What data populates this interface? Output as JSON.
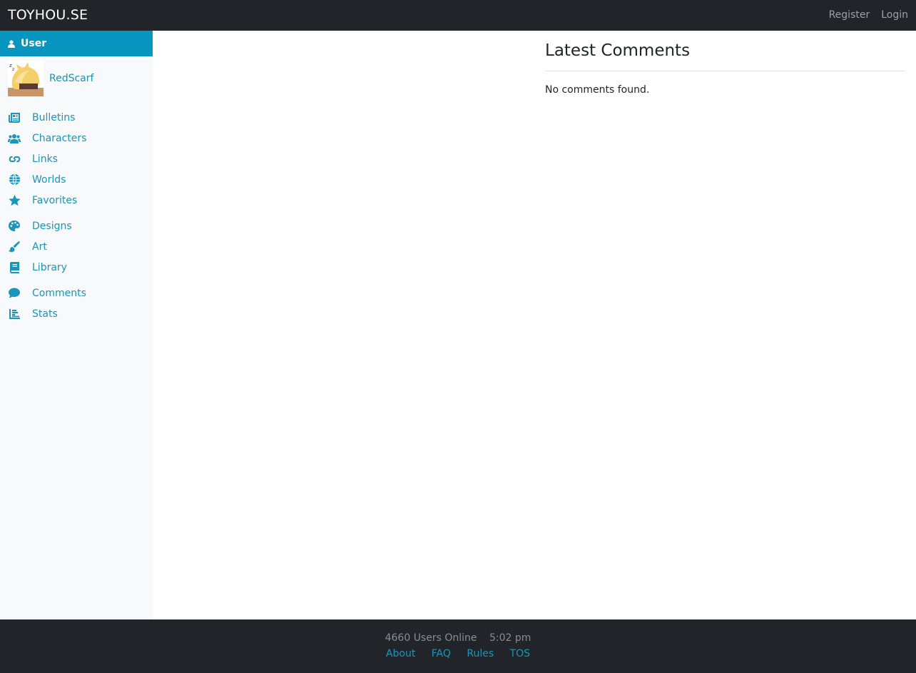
{
  "navbar": {
    "brand": "TOYHOU.SE",
    "register_label": "Register",
    "login_label": "Login"
  },
  "sidebar": {
    "header_label": "User",
    "username": "RedScarf",
    "groups": [
      [
        {
          "label": "Bulletins",
          "icon": "newspaper-icon"
        },
        {
          "label": "Characters",
          "icon": "users-icon"
        },
        {
          "label": "Links",
          "icon": "link-icon"
        },
        {
          "label": "Worlds",
          "icon": "globe-icon"
        },
        {
          "label": "Favorites",
          "icon": "star-icon"
        }
      ],
      [
        {
          "label": "Designs",
          "icon": "palette-icon"
        },
        {
          "label": "Art",
          "icon": "paintbrush-icon"
        },
        {
          "label": "Library",
          "icon": "book-icon"
        }
      ],
      [
        {
          "label": "Comments",
          "icon": "comment-icon"
        },
        {
          "label": "Stats",
          "icon": "chart-icon"
        }
      ]
    ]
  },
  "main": {
    "comments_title": "Latest Comments",
    "empty_message": "No comments found."
  },
  "footer": {
    "users_online": "4660 Users Online",
    "time": "5:02 pm",
    "links": [
      "About",
      "FAQ",
      "Rules",
      "TOS"
    ]
  },
  "colors": {
    "navbar_bg": "#212529",
    "accent": "#0895c0",
    "link": "#1b95b8",
    "sidebar_bg": "#f7f9fb"
  }
}
